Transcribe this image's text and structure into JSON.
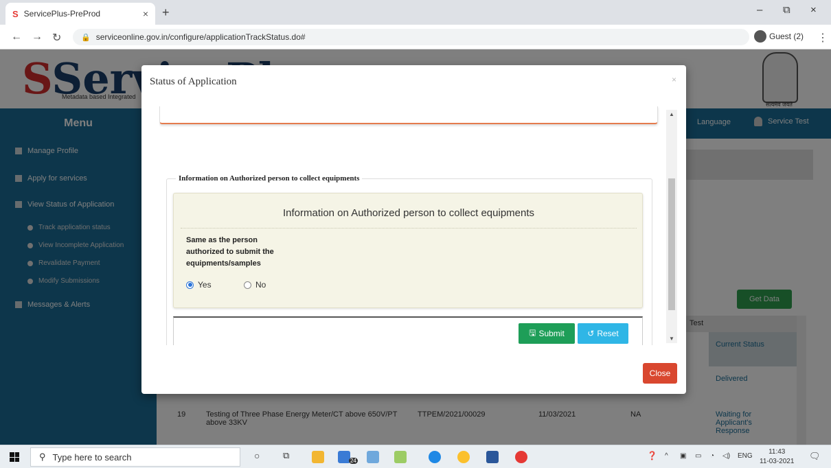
{
  "browser": {
    "tab_title": "ServicePlus-PreProd",
    "tab_close": "×",
    "new_tab": "+",
    "url": "serviceonline.gov.in/configure/applicationTrackStatus.do#",
    "profile": "Guest (2)",
    "window_controls": [
      "–",
      "⧉",
      "×"
    ]
  },
  "site": {
    "logo": "ServicePlus",
    "logo_sub": "Metadata based Integrated",
    "emblem_caption": "सत्यमेव जयते",
    "menu_title": "Menu",
    "language": "Language",
    "user": "Service Test",
    "sidebar": {
      "items": [
        {
          "label": "Manage Profile"
        },
        {
          "label": "Apply for services"
        },
        {
          "label": "View Status of Application"
        },
        {
          "label": "Messages & Alerts"
        }
      ],
      "subitems": [
        {
          "label": "Track application status"
        },
        {
          "label": "View Incomplete Application"
        },
        {
          "label": "Revalidate Payment"
        },
        {
          "label": "Modify Submissions"
        }
      ]
    },
    "get_data": "Get Data",
    "table": {
      "header": "Test",
      "current_status": "Current Status",
      "row_delivered": "Delivered",
      "row19": {
        "no": "19",
        "service": "Testing of Three Phase Energy Meter/CT above 650V/PT above 33KV",
        "ref": "TTPEM/2021/00029",
        "date": "11/03/2021",
        "na": "NA",
        "status": "Waiting for Applicant's Response"
      }
    }
  },
  "modal": {
    "title": "Status of Application",
    "close_x": "×",
    "fieldset_legend": "Information on Authorized person to collect equipments",
    "panel_title": "Information on Authorized person to collect equipments",
    "question": "Same as the person authorized to submit the equipments/samples",
    "options": [
      {
        "label": "Yes",
        "selected": true
      },
      {
        "label": "No",
        "selected": false
      }
    ],
    "submit_label": "Submit",
    "reset_label": "Reset",
    "close_label": "Close",
    "colors": {
      "submit": "#1e9e58",
      "reset": "#2fb6e6",
      "close": "#d9472f"
    }
  },
  "taskbar": {
    "search_placeholder": "Type here to search",
    "badge": "24",
    "lang": "ENG",
    "time": "11:43",
    "date": "11-03-2021"
  }
}
